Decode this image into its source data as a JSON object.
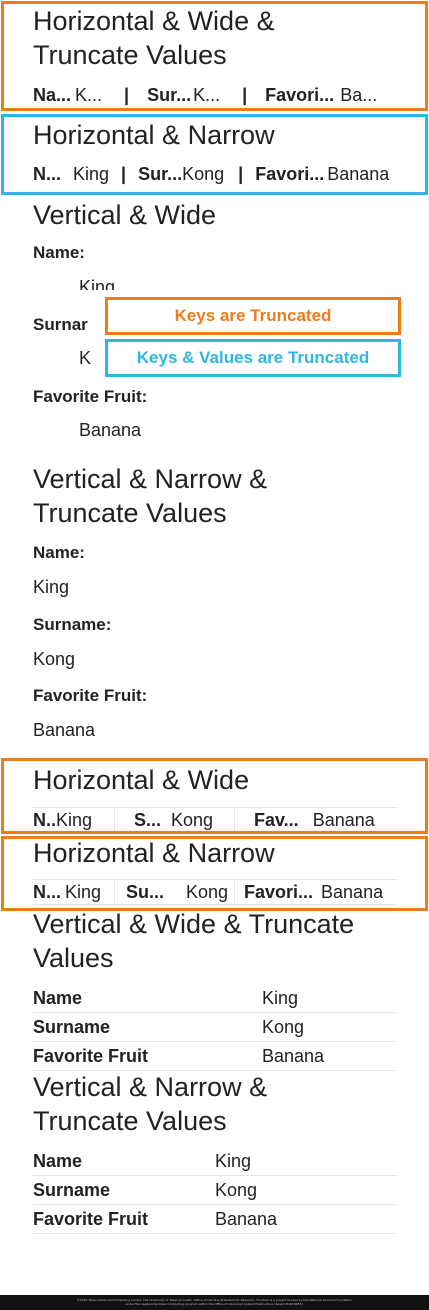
{
  "colors": {
    "orange": "#f07b1a",
    "blue": "#2fb6e4",
    "border": "#e5e5e5",
    "text": "#222222"
  },
  "s1": {
    "title_line1": "Horizontal & Wide &",
    "title_line2": "Truncate Values",
    "items": [
      {
        "k": "Na...",
        "v": "K..."
      },
      {
        "k": "Sur...",
        "v": "K..."
      },
      {
        "k": "Favori...",
        "v": "Ba..."
      }
    ],
    "sep": "|"
  },
  "s2": {
    "title": "Horizontal & Narrow",
    "items": [
      {
        "k": "N...",
        "v": "King"
      },
      {
        "k": "Sur...",
        "v": "Kong"
      },
      {
        "k": "Favori...",
        "v": "Banana"
      }
    ],
    "sep": "|"
  },
  "s3": {
    "title": "Vertical & Wide",
    "k1": "Name:",
    "v1": "King",
    "k2": "Surnar",
    "v2": "K",
    "k3": "Favorite Fruit:",
    "v3": "Banana"
  },
  "callouts": {
    "orange": "Keys are Truncated",
    "blue": "Keys & Values are Truncated"
  },
  "s4": {
    "title_line1": "Vertical & Narrow &",
    "title_line2": "Truncate Values",
    "k1": "Name:",
    "v1": "King",
    "k2": "Surname:",
    "v2": "Kong",
    "k3": "Favorite Fruit:",
    "v3": "Banana"
  },
  "s5": {
    "title": "Horizontal & Wide",
    "items": [
      {
        "k": "N..",
        "v": "King"
      },
      {
        "k": "S...",
        "v": "Kong"
      },
      {
        "k": "Fav...",
        "v": "Banana"
      }
    ]
  },
  "s6": {
    "title": "Horizontal & Narrow",
    "items": [
      {
        "k": "N...",
        "v": "King"
      },
      {
        "k": "Su...",
        "v": "Kong"
      },
      {
        "k": "Favori...",
        "v": "Banana"
      }
    ]
  },
  "s7": {
    "title_line1": "Vertical & Wide & Truncate",
    "title_line2": "Values",
    "rows": [
      {
        "k": "Name",
        "v": "King"
      },
      {
        "k": "Surname",
        "v": "Kong"
      },
      {
        "k": "Favorite Fruit",
        "v": "Banana"
      }
    ]
  },
  "s8": {
    "title_line1": "Vertical & Narrow &",
    "title_line2": "Truncate Values",
    "rows": [
      {
        "k": "Name",
        "v": "King"
      },
      {
        "k": "Surname",
        "v": "Kong"
      },
      {
        "k": "Favorite Fruit",
        "v": "Banana"
      }
    ]
  },
  "footer": "©2022 Texas Advanced Computing Center, The University of Texas at Austin, Office of the Vice President for Research. Frontera is a project funded by the National Science Foundation under the Leadership-Class Computing program within the Office of Advanced Cyberinfrastructure (Award #1818253)."
}
